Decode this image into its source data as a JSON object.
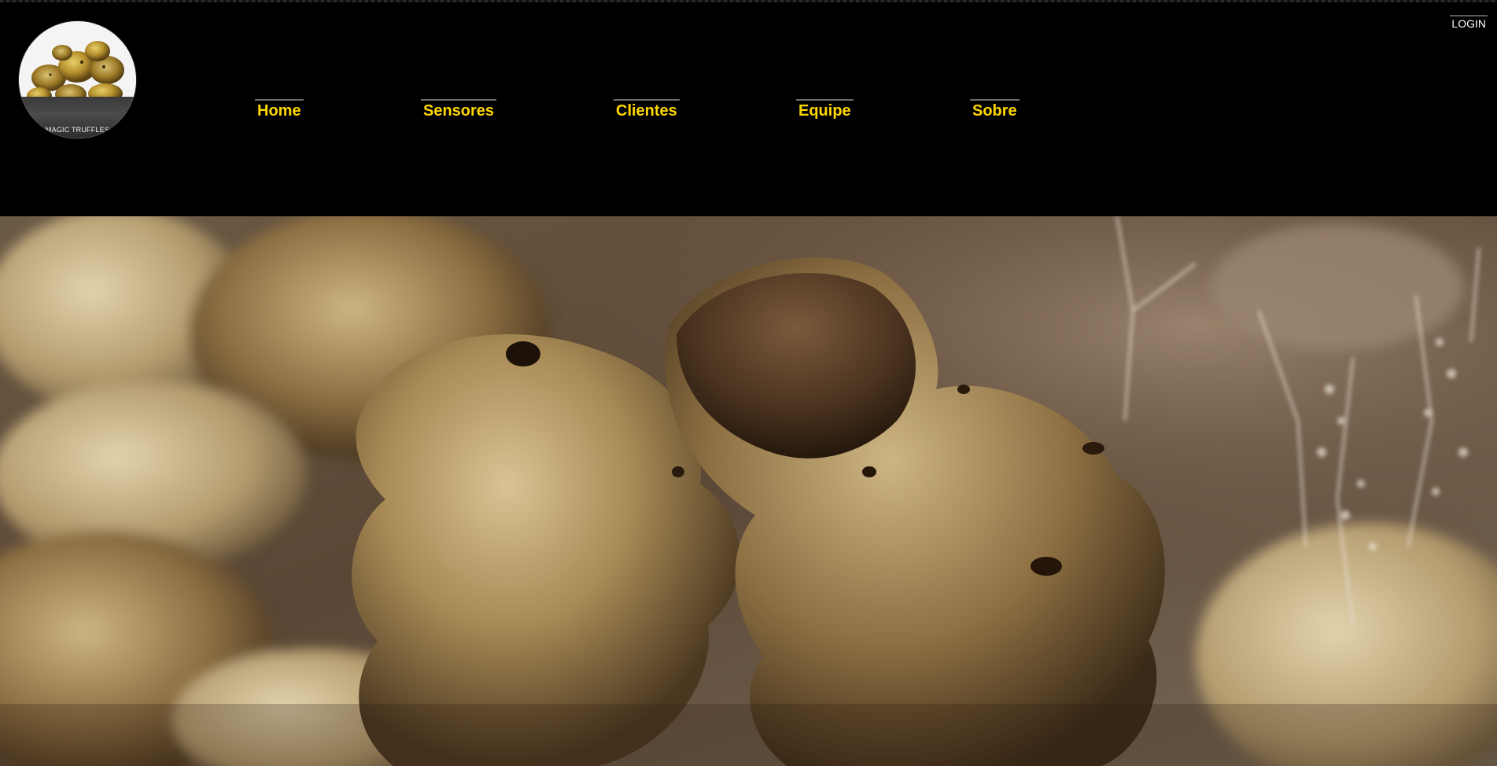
{
  "brand": {
    "logo_text": "MAGIC TRUFFLES",
    "logo_icon": "truffles-logo-icon"
  },
  "nav": {
    "items": [
      {
        "label": "Home"
      },
      {
        "label": "Sensores"
      },
      {
        "label": "Clientes"
      },
      {
        "label": "Equipe"
      },
      {
        "label": "Sobre"
      }
    ],
    "login_label": "LOGIN"
  },
  "hero": {
    "image": "truffles-hero-image"
  },
  "colors": {
    "background": "#000000",
    "nav_text": "#ffd700",
    "login_text": "#ffffff"
  }
}
